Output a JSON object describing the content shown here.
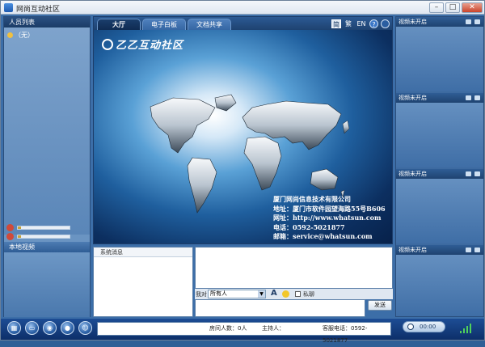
{
  "window": {
    "title": "网尚互动社区",
    "minimize": "–",
    "maximize": "□",
    "close": "✕"
  },
  "left": {
    "user_list_title": "人员列表",
    "user_item": "（无）",
    "local_video_title": "本地视频"
  },
  "center": {
    "tabs": [
      {
        "label": "大厅",
        "active": true
      },
      {
        "label": "电子白板",
        "active": false
      },
      {
        "label": "文档共享",
        "active": false
      }
    ],
    "lang": {
      "simplified": "简",
      "traditional": "繁",
      "english": "EN"
    },
    "help": "?",
    "brand": "乙乙互动社区",
    "company": {
      "name": "厦门网尚信息技术有限公司",
      "address": "地址：厦门市软件园望海路55号B606",
      "website": "网址：http://www.whatsun.com",
      "phone": "电话：0592-5021877",
      "email": "邮箱：service@whatsun.com"
    }
  },
  "bottom": {
    "system_messages_title": "系统消息",
    "chat_to_label": "我对",
    "chat_target": "所有人",
    "font_button": "A",
    "private_label": "私聊",
    "send_button": "发送"
  },
  "right": {
    "video_slots": [
      "视频未开启",
      "视频未开启",
      "视频未开启",
      "视频未开启"
    ]
  },
  "status": {
    "room_count": "房间人数：0人",
    "host": "主持人：",
    "service_phone": "客服电话：0592-5021877",
    "timer": "00:00"
  },
  "colors": {
    "accent": "#1e4270",
    "panel": "#3d6aa0"
  }
}
